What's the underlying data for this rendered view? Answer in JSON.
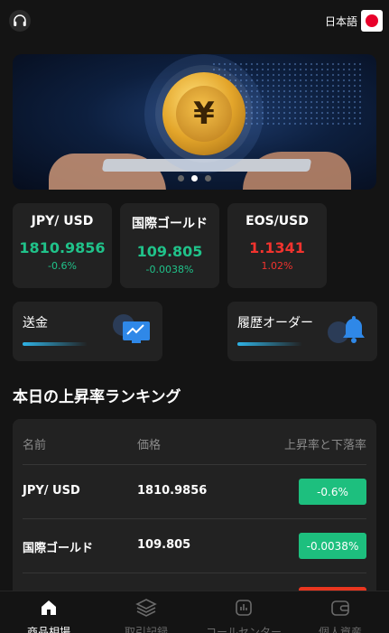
{
  "header": {
    "support_icon": "headset-icon",
    "language_label": "日本語",
    "flag_icon": "japan-flag-icon"
  },
  "banner": {
    "image": "yen-coin-tablet-hands",
    "slides": 3,
    "active_slide": 2
  },
  "tickers": [
    {
      "name": "JPY/ USD",
      "price": "1810.9856",
      "change": "-0.6%",
      "color": "#20c28a"
    },
    {
      "name": "国際ゴールド",
      "price": "109.805",
      "change": "-0.0038%",
      "color": "#20c28a"
    },
    {
      "name": "EOS/USD",
      "price": "1.1341",
      "change": "1.02%",
      "color": "#f2332e"
    }
  ],
  "actions": {
    "send_label": "送金",
    "send_icon": "chart-monitor-icon",
    "history_label": "履歴オーダー",
    "history_icon": "bell-icon"
  },
  "ranking": {
    "title": "本日の上昇率ランキング",
    "headers": {
      "name": "名前",
      "price": "価格",
      "change": "上昇率と下落率"
    },
    "rows": [
      {
        "name": "JPY/ USD",
        "price": "1810.9856",
        "change": "-0.6%",
        "status": "up"
      },
      {
        "name": "国際ゴールド",
        "price": "109.805",
        "change": "-0.0038%",
        "status": "up"
      },
      {
        "name": "",
        "price": "",
        "change": "",
        "status": "down"
      }
    ]
  },
  "tabbar": {
    "tabs": [
      {
        "label": "商品相場",
        "icon": "home-icon",
        "active": true
      },
      {
        "label": "取引記録",
        "icon": "layers-icon",
        "active": false
      },
      {
        "label": "コールセンター",
        "icon": "bar-chart-icon",
        "active": false
      },
      {
        "label": "個人資産",
        "icon": "wallet-icon",
        "active": false
      }
    ]
  },
  "colors": {
    "background": "#141414",
    "card": "#222222",
    "up": "#1dbf7e",
    "down": "#e9361f",
    "accent": "#2fb3e6"
  }
}
